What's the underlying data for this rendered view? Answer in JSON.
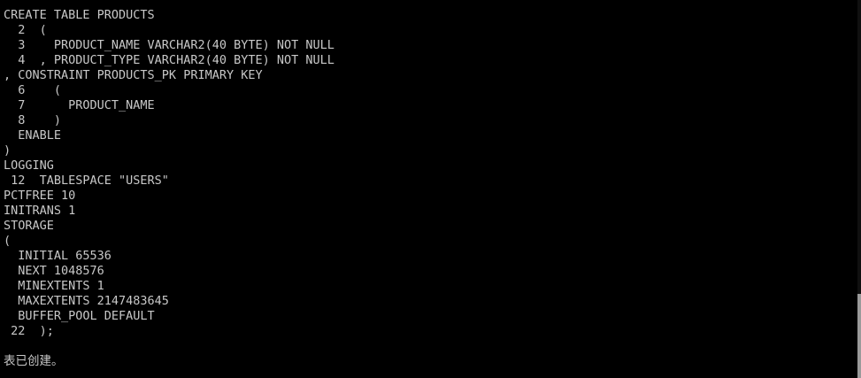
{
  "console": {
    "lines": [
      "CREATE TABLE PRODUCTS",
      "  2  (",
      "  3    PRODUCT_NAME VARCHAR2(40 BYTE) NOT NULL",
      "  4  , PRODUCT_TYPE VARCHAR2(40 BYTE) NOT NULL",
      ", CONSTRAINT PRODUCTS_PK PRIMARY KEY",
      "  6    (",
      "  7      PRODUCT_NAME",
      "  8    )",
      "  ENABLE",
      ")",
      "LOGGING",
      " 12  TABLESPACE \"USERS\"",
      "PCTFREE 10",
      "INITRANS 1",
      "STORAGE",
      "(",
      "  INITIAL 65536",
      "  NEXT 1048576",
      "  MINEXTENTS 1",
      "  MAXEXTENTS 2147483645",
      "  BUFFER_POOL DEFAULT",
      " 22  );",
      "",
      "表已创建。"
    ]
  },
  "colors": {
    "background": "#000000",
    "text": "#c8c8c8",
    "scrollbar_thumb": "#9a9a9a"
  }
}
